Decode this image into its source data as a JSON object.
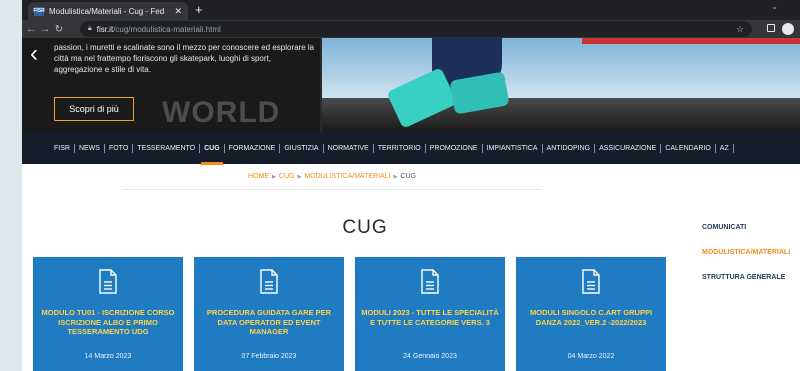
{
  "browser": {
    "tab_title": "Modulistica/Materiali - Cug - Fed",
    "tab_favicon_text": "FISR",
    "url_host": "fisr.it",
    "url_path": "/cug/modulistica-materiali.html"
  },
  "hero": {
    "text": "passion, i muretti e scalinate sono il mezzo per conoscere ed esplorare la città ma nel frattempo fioriscono gli skatepark, luoghi di sport, aggregazione e stile di vita.",
    "cta_label": "Scopri di più",
    "bg_word": "WORLD"
  },
  "nav": {
    "items": [
      "FISR",
      "NEWS",
      "FOTO",
      "TESSERAMENTO",
      "CUG",
      "FORMAZIONE",
      "GIUSTIZIA",
      "NORMATIVE",
      "TERRITORIO",
      "PROMOZIONE",
      "IMPIANTISTICA",
      "ANTIDOPING",
      "ASSICURAZIONE",
      "CALENDARIO",
      "AZ"
    ],
    "active": "CUG"
  },
  "breadcrumb": [
    "HOME",
    "CUG",
    "MODULISTICA/MATERIALI",
    "CUG"
  ],
  "page_title": "CUG",
  "cards": [
    {
      "title": "MODULO TU01 - ISCRIZIONE CORSO ISCRIZIONE ALBO E PRIMO TESSERAMENTO UDG",
      "date": "14 Marzo 2023"
    },
    {
      "title": "PROCEDURA GUIDATA GARE PER DATA OPERATOR ED EVENT MANAGER",
      "date": "07 Febbraio 2023"
    },
    {
      "title": "MODULI 2023 - TUTTE LE SPECIALITÀ E TUTTE LE CATEGORIE VERS. 3",
      "date": "24 Gennaio 2023"
    },
    {
      "title": "MODULI SINGOLO C.ART GRUPPI DANZA 2022_VER.2 -2022/2023",
      "date": "04 Marzo 2022"
    }
  ],
  "sidebar": {
    "items": [
      "COMUNICATI",
      "MODULISTICA/MATERIALI",
      "STRUTTURA GENERALE"
    ],
    "active": "MODULISTICA/MATERIALI"
  },
  "colors": {
    "accent": "#f28c1c",
    "card_bg": "#1f7bc2",
    "card_title": "#ffd34a",
    "nav_bg": "#151c2a"
  }
}
